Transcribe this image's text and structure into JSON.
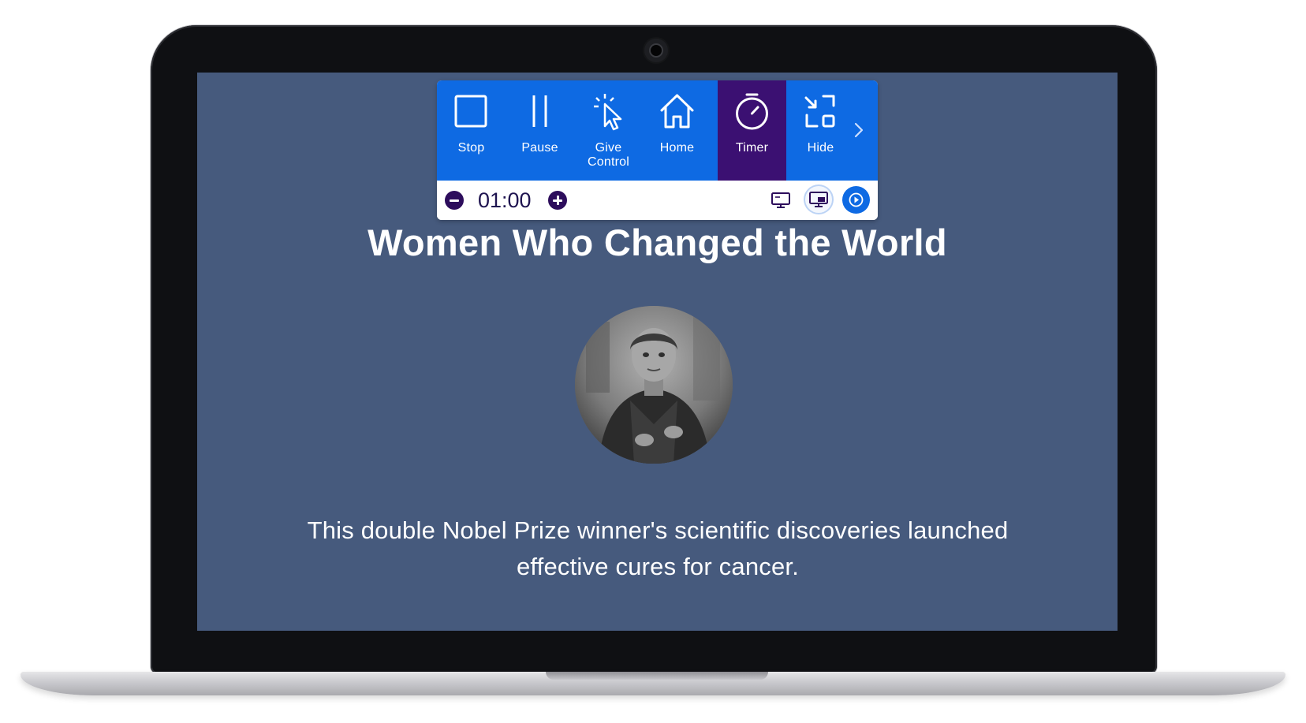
{
  "toolbar": {
    "buttons": [
      {
        "label": "Stop",
        "icon": "stop-icon"
      },
      {
        "label": "Pause",
        "icon": "pause-icon"
      },
      {
        "label": "Give\nControl",
        "icon": "cursor-click-icon"
      },
      {
        "label": "Home",
        "icon": "home-icon"
      },
      {
        "label": "Timer",
        "icon": "stopwatch-icon",
        "active": true
      },
      {
        "label": "Hide",
        "icon": "collapse-icon"
      }
    ],
    "more_icon": "chevron-right-icon",
    "timer": {
      "value": "01:00",
      "decrease_icon": "minus-circle-icon",
      "increase_icon": "plus-circle-icon"
    },
    "display_icons": [
      "monitor-icon",
      "picture-in-picture-icon",
      "play-icon"
    ]
  },
  "slide": {
    "title": "Women Who Changed the World",
    "body": "This double Nobel Prize winner's scientific discoveries launched effective cures for cancer."
  },
  "colors": {
    "screen_bg": "#465a7d",
    "toolbar_blue": "#0e6ae3",
    "active_purple": "#3b1072",
    "timer_text": "#1f1450"
  }
}
